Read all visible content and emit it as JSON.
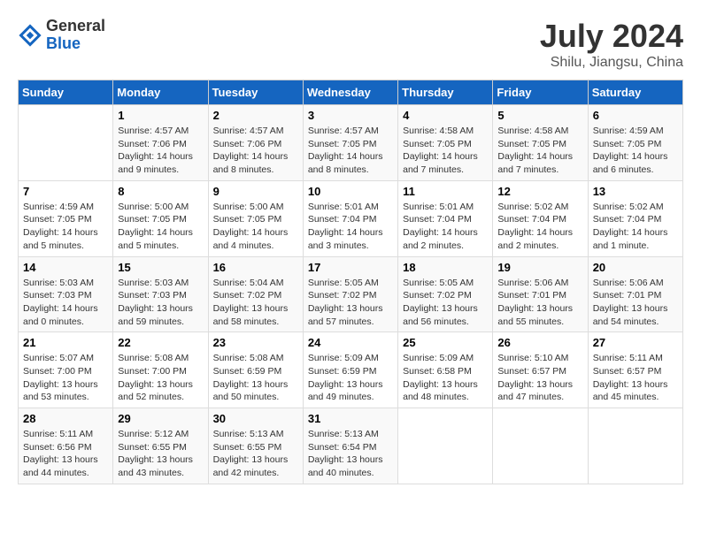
{
  "logo": {
    "general": "General",
    "blue": "Blue"
  },
  "title": "July 2024",
  "location": "Shilu, Jiangsu, China",
  "days_of_week": [
    "Sunday",
    "Monday",
    "Tuesday",
    "Wednesday",
    "Thursday",
    "Friday",
    "Saturday"
  ],
  "weeks": [
    [
      {
        "day": "",
        "sunrise": "",
        "sunset": "",
        "daylight": ""
      },
      {
        "day": "1",
        "sunrise": "Sunrise: 4:57 AM",
        "sunset": "Sunset: 7:06 PM",
        "daylight": "Daylight: 14 hours and 9 minutes."
      },
      {
        "day": "2",
        "sunrise": "Sunrise: 4:57 AM",
        "sunset": "Sunset: 7:06 PM",
        "daylight": "Daylight: 14 hours and 8 minutes."
      },
      {
        "day": "3",
        "sunrise": "Sunrise: 4:57 AM",
        "sunset": "Sunset: 7:05 PM",
        "daylight": "Daylight: 14 hours and 8 minutes."
      },
      {
        "day": "4",
        "sunrise": "Sunrise: 4:58 AM",
        "sunset": "Sunset: 7:05 PM",
        "daylight": "Daylight: 14 hours and 7 minutes."
      },
      {
        "day": "5",
        "sunrise": "Sunrise: 4:58 AM",
        "sunset": "Sunset: 7:05 PM",
        "daylight": "Daylight: 14 hours and 7 minutes."
      },
      {
        "day": "6",
        "sunrise": "Sunrise: 4:59 AM",
        "sunset": "Sunset: 7:05 PM",
        "daylight": "Daylight: 14 hours and 6 minutes."
      }
    ],
    [
      {
        "day": "7",
        "sunrise": "Sunrise: 4:59 AM",
        "sunset": "Sunset: 7:05 PM",
        "daylight": "Daylight: 14 hours and 5 minutes."
      },
      {
        "day": "8",
        "sunrise": "Sunrise: 5:00 AM",
        "sunset": "Sunset: 7:05 PM",
        "daylight": "Daylight: 14 hours and 5 minutes."
      },
      {
        "day": "9",
        "sunrise": "Sunrise: 5:00 AM",
        "sunset": "Sunset: 7:05 PM",
        "daylight": "Daylight: 14 hours and 4 minutes."
      },
      {
        "day": "10",
        "sunrise": "Sunrise: 5:01 AM",
        "sunset": "Sunset: 7:04 PM",
        "daylight": "Daylight: 14 hours and 3 minutes."
      },
      {
        "day": "11",
        "sunrise": "Sunrise: 5:01 AM",
        "sunset": "Sunset: 7:04 PM",
        "daylight": "Daylight: 14 hours and 2 minutes."
      },
      {
        "day": "12",
        "sunrise": "Sunrise: 5:02 AM",
        "sunset": "Sunset: 7:04 PM",
        "daylight": "Daylight: 14 hours and 2 minutes."
      },
      {
        "day": "13",
        "sunrise": "Sunrise: 5:02 AM",
        "sunset": "Sunset: 7:04 PM",
        "daylight": "Daylight: 14 hours and 1 minute."
      }
    ],
    [
      {
        "day": "14",
        "sunrise": "Sunrise: 5:03 AM",
        "sunset": "Sunset: 7:03 PM",
        "daylight": "Daylight: 14 hours and 0 minutes."
      },
      {
        "day": "15",
        "sunrise": "Sunrise: 5:03 AM",
        "sunset": "Sunset: 7:03 PM",
        "daylight": "Daylight: 13 hours and 59 minutes."
      },
      {
        "day": "16",
        "sunrise": "Sunrise: 5:04 AM",
        "sunset": "Sunset: 7:02 PM",
        "daylight": "Daylight: 13 hours and 58 minutes."
      },
      {
        "day": "17",
        "sunrise": "Sunrise: 5:05 AM",
        "sunset": "Sunset: 7:02 PM",
        "daylight": "Daylight: 13 hours and 57 minutes."
      },
      {
        "day": "18",
        "sunrise": "Sunrise: 5:05 AM",
        "sunset": "Sunset: 7:02 PM",
        "daylight": "Daylight: 13 hours and 56 minutes."
      },
      {
        "day": "19",
        "sunrise": "Sunrise: 5:06 AM",
        "sunset": "Sunset: 7:01 PM",
        "daylight": "Daylight: 13 hours and 55 minutes."
      },
      {
        "day": "20",
        "sunrise": "Sunrise: 5:06 AM",
        "sunset": "Sunset: 7:01 PM",
        "daylight": "Daylight: 13 hours and 54 minutes."
      }
    ],
    [
      {
        "day": "21",
        "sunrise": "Sunrise: 5:07 AM",
        "sunset": "Sunset: 7:00 PM",
        "daylight": "Daylight: 13 hours and 53 minutes."
      },
      {
        "day": "22",
        "sunrise": "Sunrise: 5:08 AM",
        "sunset": "Sunset: 7:00 PM",
        "daylight": "Daylight: 13 hours and 52 minutes."
      },
      {
        "day": "23",
        "sunrise": "Sunrise: 5:08 AM",
        "sunset": "Sunset: 6:59 PM",
        "daylight": "Daylight: 13 hours and 50 minutes."
      },
      {
        "day": "24",
        "sunrise": "Sunrise: 5:09 AM",
        "sunset": "Sunset: 6:59 PM",
        "daylight": "Daylight: 13 hours and 49 minutes."
      },
      {
        "day": "25",
        "sunrise": "Sunrise: 5:09 AM",
        "sunset": "Sunset: 6:58 PM",
        "daylight": "Daylight: 13 hours and 48 minutes."
      },
      {
        "day": "26",
        "sunrise": "Sunrise: 5:10 AM",
        "sunset": "Sunset: 6:57 PM",
        "daylight": "Daylight: 13 hours and 47 minutes."
      },
      {
        "day": "27",
        "sunrise": "Sunrise: 5:11 AM",
        "sunset": "Sunset: 6:57 PM",
        "daylight": "Daylight: 13 hours and 45 minutes."
      }
    ],
    [
      {
        "day": "28",
        "sunrise": "Sunrise: 5:11 AM",
        "sunset": "Sunset: 6:56 PM",
        "daylight": "Daylight: 13 hours and 44 minutes."
      },
      {
        "day": "29",
        "sunrise": "Sunrise: 5:12 AM",
        "sunset": "Sunset: 6:55 PM",
        "daylight": "Daylight: 13 hours and 43 minutes."
      },
      {
        "day": "30",
        "sunrise": "Sunrise: 5:13 AM",
        "sunset": "Sunset: 6:55 PM",
        "daylight": "Daylight: 13 hours and 42 minutes."
      },
      {
        "day": "31",
        "sunrise": "Sunrise: 5:13 AM",
        "sunset": "Sunset: 6:54 PM",
        "daylight": "Daylight: 13 hours and 40 minutes."
      },
      {
        "day": "",
        "sunrise": "",
        "sunset": "",
        "daylight": ""
      },
      {
        "day": "",
        "sunrise": "",
        "sunset": "",
        "daylight": ""
      },
      {
        "day": "",
        "sunrise": "",
        "sunset": "",
        "daylight": ""
      }
    ]
  ]
}
